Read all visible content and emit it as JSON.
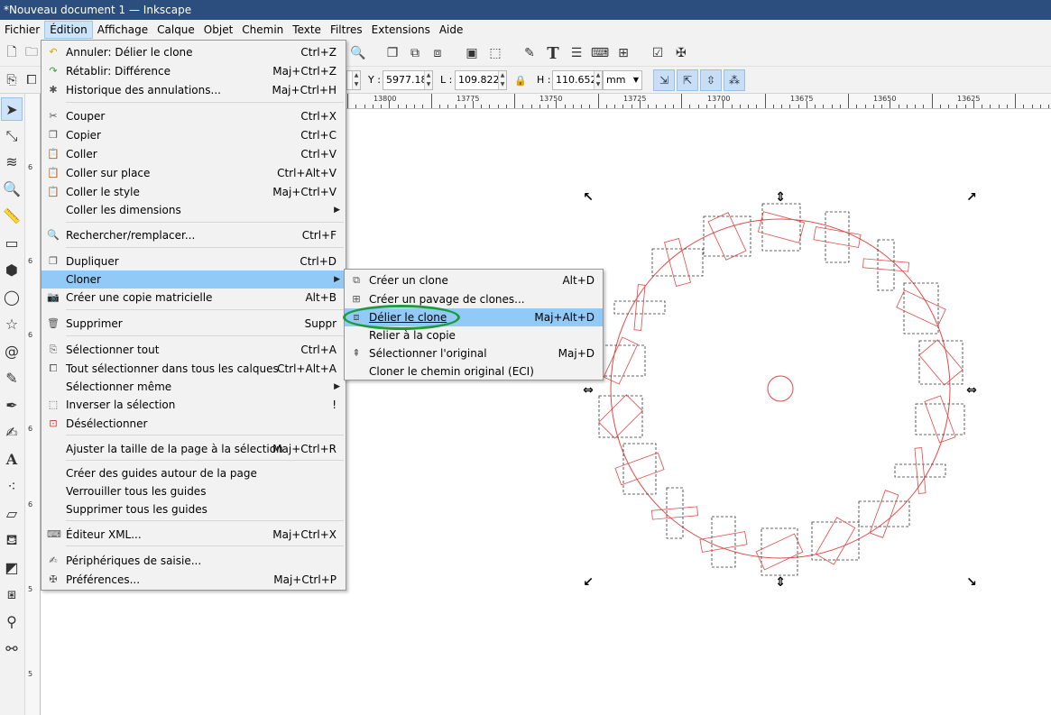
{
  "window": {
    "title": "*Nouveau document 1 — Inkscape"
  },
  "menubar": {
    "items": [
      "Fichier",
      "Édition",
      "Affichage",
      "Calque",
      "Objet",
      "Chemin",
      "Texte",
      "Filtres",
      "Extensions",
      "Aide"
    ],
    "active": "Édition"
  },
  "controls": {
    "y_label": "Y :",
    "y_value": "5977.18",
    "w_label": "L :",
    "w_value": "109.822",
    "h_label": "H :",
    "h_value": "110.652",
    "unit": "mm"
  },
  "ruler": {
    "h_labels": [
      "13800",
      "13775",
      "13750",
      "13725",
      "13700",
      "13675",
      "13650",
      "13625"
    ],
    "v_labels": [
      "6",
      "6",
      "6",
      "6",
      "6",
      "5",
      "5"
    ]
  },
  "edit_menu": {
    "items": [
      {
        "label": "Annuler: Délier le clone",
        "accel": "Ctrl+Z",
        "icon": "undo-icon"
      },
      {
        "label": "Rétablir: Différence",
        "accel": "Maj+Ctrl+Z",
        "icon": "redo-icon"
      },
      {
        "label": "Historique des annulations...",
        "accel": "Maj+Ctrl+H",
        "icon": "history-icon"
      },
      {
        "label": "Couper",
        "accel": "Ctrl+X",
        "icon": "cut-icon"
      },
      {
        "label": "Copier",
        "accel": "Ctrl+C",
        "icon": "copy-icon"
      },
      {
        "label": "Coller",
        "accel": "Ctrl+V",
        "icon": "paste-icon"
      },
      {
        "label": "Coller sur place",
        "accel": "Ctrl+Alt+V",
        "icon": "paste-in-place-icon"
      },
      {
        "label": "Coller le style",
        "accel": "Maj+Ctrl+V",
        "icon": "paste-style-icon"
      },
      {
        "label": "Coller les dimensions",
        "accel": "",
        "icon": ""
      },
      {
        "label": "Rechercher/remplacer...",
        "accel": "Ctrl+F",
        "icon": "search-icon"
      },
      {
        "label": "Dupliquer",
        "accel": "Ctrl+D",
        "icon": "duplicate-icon"
      },
      {
        "label": "Cloner",
        "accel": "",
        "icon": ""
      },
      {
        "label": "Créer une copie matricielle",
        "accel": "Alt+B",
        "icon": "bitmap-copy-icon"
      },
      {
        "label": "Supprimer",
        "accel": "Suppr",
        "icon": "delete-icon"
      },
      {
        "label": "Sélectionner tout",
        "accel": "Ctrl+A",
        "icon": "select-all-icon"
      },
      {
        "label": "Tout sélectionner dans tous les calques",
        "accel": "Ctrl+Alt+A",
        "icon": "select-all-layers-icon"
      },
      {
        "label": "Sélectionner même",
        "accel": "",
        "icon": ""
      },
      {
        "label": "Inverser la sélection",
        "accel": "!",
        "icon": "invert-selection-icon"
      },
      {
        "label": "Désélectionner",
        "accel": "",
        "icon": "deselect-icon"
      },
      {
        "label": "Ajuster la taille de la page à la sélection",
        "accel": "Maj+Ctrl+R",
        "icon": ""
      },
      {
        "label": "Créer des guides autour de la page",
        "accel": "",
        "icon": ""
      },
      {
        "label": "Verrouiller tous les guides",
        "accel": "",
        "icon": ""
      },
      {
        "label": "Supprimer tous les guides",
        "accel": "",
        "icon": ""
      },
      {
        "label": "Éditeur XML...",
        "accel": "Maj+Ctrl+X",
        "icon": "xml-editor-icon"
      },
      {
        "label": "Périphériques de saisie...",
        "accel": "",
        "icon": "input-devices-icon"
      },
      {
        "label": "Préférences...",
        "accel": "Maj+Ctrl+P",
        "icon": "preferences-icon"
      }
    ]
  },
  "clone_menu": {
    "items": [
      {
        "label": "Créer un clone",
        "accel": "Alt+D",
        "icon": "clone-icon"
      },
      {
        "label": "Créer un pavage de clones...",
        "accel": "",
        "icon": "tile-clones-icon"
      },
      {
        "label": "Délier le clone",
        "accel": "Maj+Alt+D",
        "icon": "unlink-clone-icon"
      },
      {
        "label": "Relier à la copie",
        "accel": "",
        "icon": ""
      },
      {
        "label": "Sélectionner l'original",
        "accel": "Maj+D",
        "icon": "select-original-icon"
      },
      {
        "label": "Cloner le chemin original (ECI)",
        "accel": "",
        "icon": ""
      }
    ]
  },
  "colors": {
    "title_bar": "#2b4e7e",
    "menu_highlight": "#91c9f7",
    "object_stroke": "#e04848",
    "callout_ring": "#1f9c3a"
  }
}
